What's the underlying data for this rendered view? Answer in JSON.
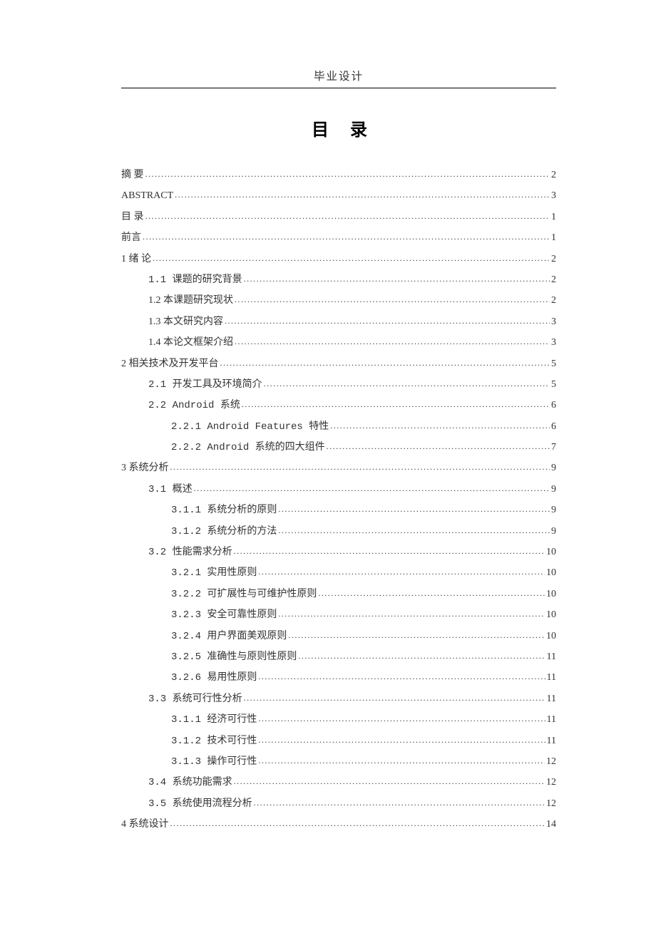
{
  "header": "毕业设计",
  "toc_title": "目 录",
  "entries": [
    {
      "level": 0,
      "label": "摘   要",
      "page": "2",
      "mono": false
    },
    {
      "level": 0,
      "label": "ABSTRACT",
      "page": "3",
      "mono": false
    },
    {
      "level": 0,
      "label": "目 录",
      "page": "1",
      "mono": false
    },
    {
      "level": 0,
      "label": "前言",
      "page": "1",
      "mono": false
    },
    {
      "level": 0,
      "label": "1 绪 论",
      "page": "2",
      "mono": false
    },
    {
      "level": 1,
      "label": "1.1 课题的研究背景",
      "page": "2",
      "mono": true
    },
    {
      "level": 1,
      "label": "1.2 本课题研究现状",
      "page": "2",
      "mono": false
    },
    {
      "level": 1,
      "label": "1.3 本文研究内容",
      "page": "3",
      "mono": false
    },
    {
      "level": 1,
      "label": "1.4 本论文框架介绍",
      "page": "3",
      "mono": false
    },
    {
      "level": 0,
      "label": "2 相关技术及开发平台",
      "page": "5",
      "mono": false
    },
    {
      "level": 1,
      "label": "2.1 开发工具及环境简介",
      "page": "5",
      "mono": true
    },
    {
      "level": 1,
      "label": "2.2 Android 系统",
      "page": "6",
      "mono": true
    },
    {
      "level": 2,
      "label": "2.2.1 Android Features 特性",
      "page": "6",
      "mono": true
    },
    {
      "level": 2,
      "label": "2.2.2 Android 系统的四大组件",
      "page": "7",
      "mono": true
    },
    {
      "level": 0,
      "label": "3  系统分析",
      "page": "9",
      "mono": false
    },
    {
      "level": 1,
      "label": "3.1 概述",
      "page": "9",
      "mono": true
    },
    {
      "level": 2,
      "label": "3.1.1 系统分析的原则",
      "page": "9",
      "mono": true
    },
    {
      "level": 2,
      "label": "3.1.2 系统分析的方法",
      "page": "9",
      "mono": true
    },
    {
      "level": 1,
      "label": "3.2 性能需求分析",
      "page": "10",
      "mono": true
    },
    {
      "level": 2,
      "label": "3.2.1  实用性原则",
      "page": "10",
      "mono": true
    },
    {
      "level": 2,
      "label": "3.2.2  可扩展性与可维护性原则",
      "page": "10",
      "mono": true
    },
    {
      "level": 2,
      "label": "3.2.3  安全可靠性原则",
      "page": "10",
      "mono": true
    },
    {
      "level": 2,
      "label": "3.2.4  用户界面美观原则",
      "page": "10",
      "mono": true
    },
    {
      "level": 2,
      "label": "3.2.5  准确性与原则性原则",
      "page": "11",
      "mono": true
    },
    {
      "level": 2,
      "label": "3.2.6  易用性原则",
      "page": "11",
      "mono": true
    },
    {
      "level": 1,
      "label": "3.3 系统可行性分析",
      "page": "11",
      "mono": true
    },
    {
      "level": 2,
      "label": "3.1.1  经济可行性",
      "page": "11",
      "mono": true
    },
    {
      "level": 2,
      "label": "3.1.2  技术可行性",
      "page": "11",
      "mono": true
    },
    {
      "level": 2,
      "label": "3.1.3  操作可行性",
      "page": "12",
      "mono": true
    },
    {
      "level": 1,
      "label": "3.4 系统功能需求",
      "page": "12",
      "mono": true
    },
    {
      "level": 1,
      "label": "3.5 系统使用流程分析",
      "page": "12",
      "mono": true
    },
    {
      "level": 0,
      "label": "4  系统设计",
      "page": "14",
      "mono": false
    }
  ]
}
